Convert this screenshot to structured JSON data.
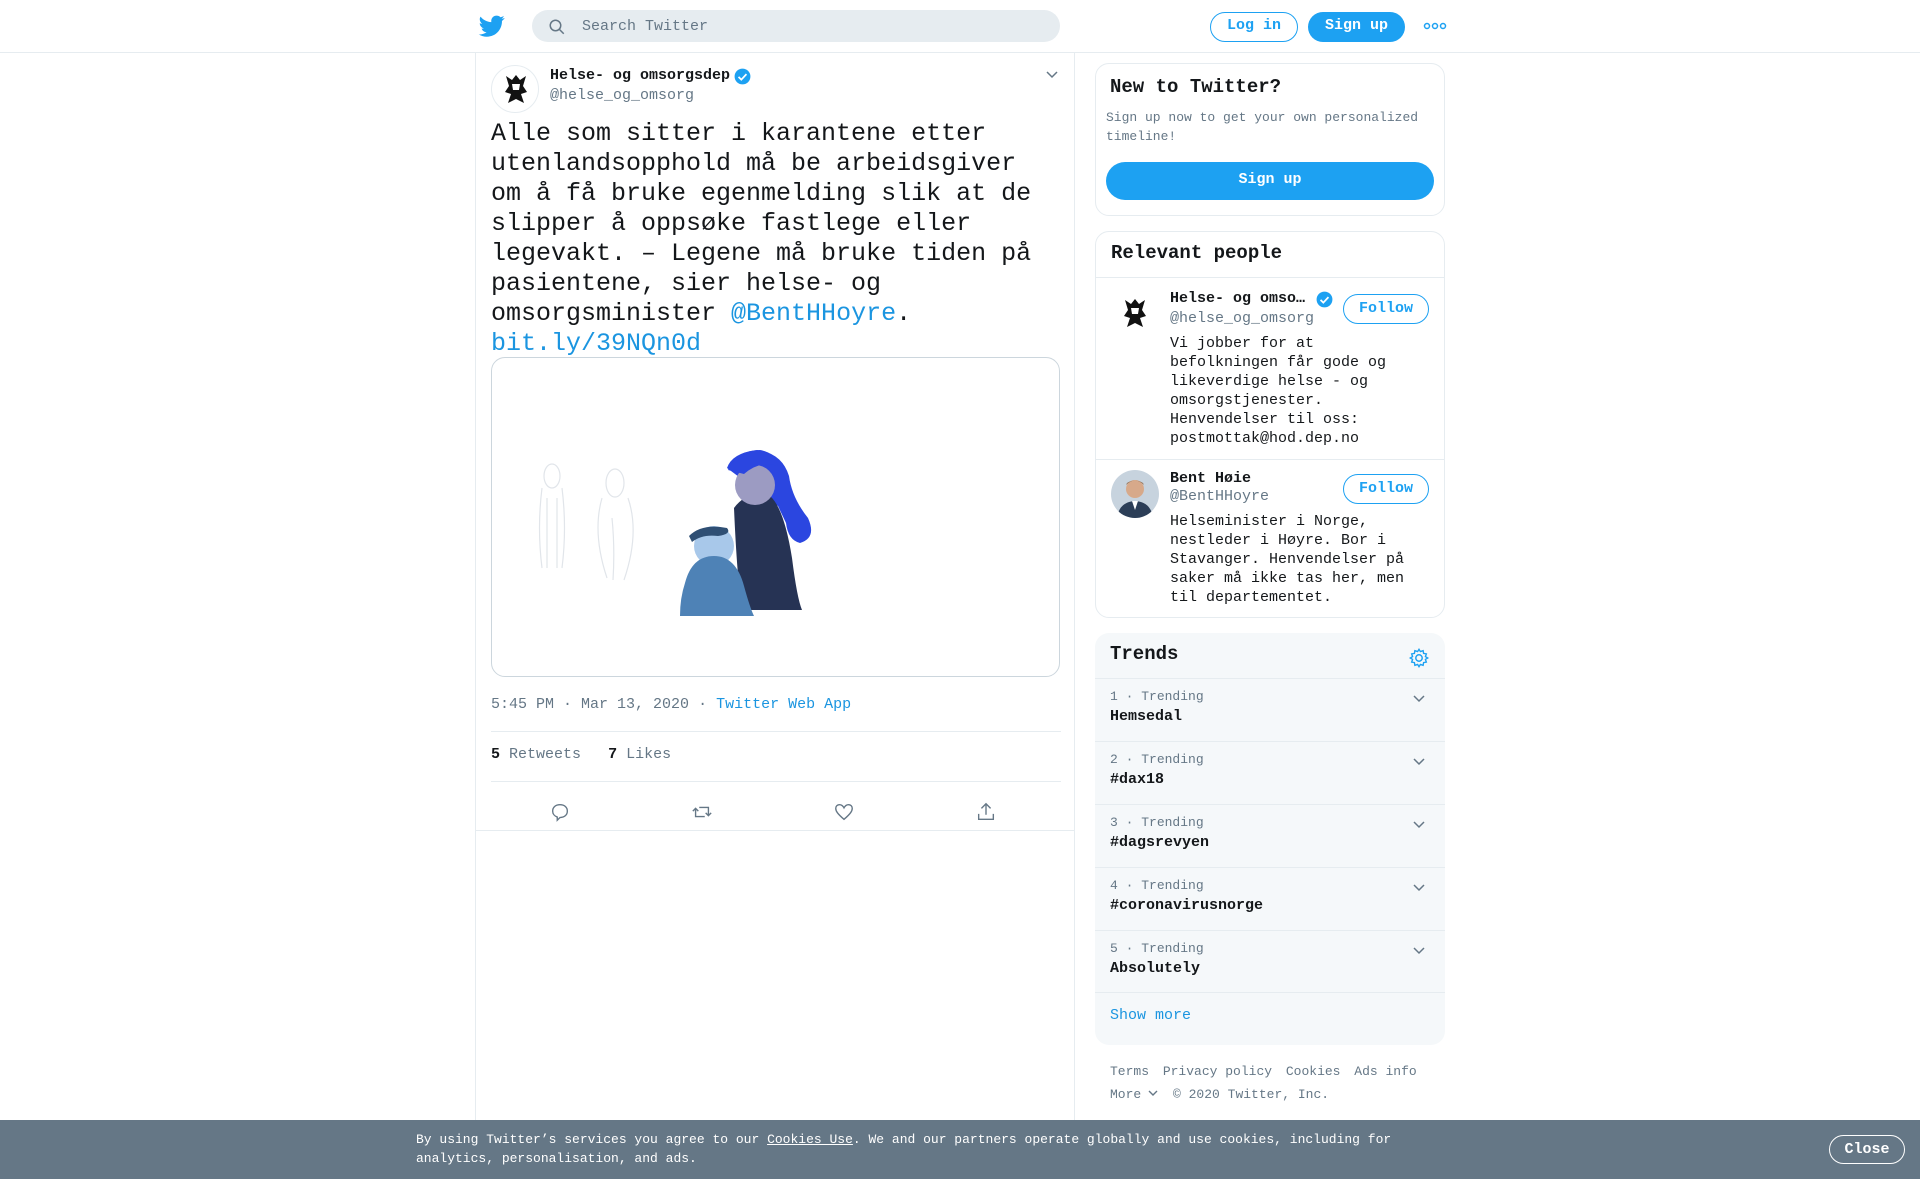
{
  "header": {
    "search_placeholder": "Search Twitter",
    "login_label": "Log in",
    "signup_label": "Sign up",
    "more_icon": "more-icon",
    "brand_color": "#1da1f2"
  },
  "tweet": {
    "author_name": "Helse- og omsorgsdep",
    "author_handle": "@helse_og_omsorg",
    "verified": true,
    "text_part1": "Alle som sitter i karantene etter utenlandsopphold må be arbeidsgiver om å få bruke egenmelding slik at de slipper å oppsøke fastlege eller legevakt. – Legene må bruke tiden på pasientene, sier helse- og omsorgsminister ",
    "mention": "@BentHHoyre",
    "text_part2": ".",
    "url": "bit.ly/39NQn0d",
    "timestamp": "5:45 PM · Mar 13, 2020",
    "dot": "·",
    "source": "Twitter Web App",
    "retweets_count": "5",
    "retweets_label": "Retweets",
    "likes_count": "7",
    "likes_label": "Likes"
  },
  "sidebar": {
    "new_to_twitter": {
      "title": "New to Twitter?",
      "description": "Sign up now to get your own personalized timeline!",
      "button": "Sign up"
    },
    "relevant_people": {
      "title": "Relevant people",
      "people": [
        {
          "name": "Helse- og omso…",
          "handle": "@helse_og_omsorg",
          "verified": true,
          "follow_label": "Follow",
          "bio": "Vi jobber for at befolkningen får gode og likeverdige helse - og omsorgstjenester. Henvendelser til oss: postmottak@hod.dep.no"
        },
        {
          "name": "Bent Høie",
          "handle": "@BentHHoyre",
          "verified": false,
          "follow_label": "Follow",
          "bio": "Helseminister i Norge, nestleder i Høyre. Bor i Stavanger. Henvendelser på saker må ikke tas her, men til departementet."
        }
      ]
    },
    "trends": {
      "title": "Trends",
      "items": [
        {
          "rank": "1",
          "label": "Trending",
          "name": "Hemsedal"
        },
        {
          "rank": "2",
          "label": "Trending",
          "name": "#dax18"
        },
        {
          "rank": "3",
          "label": "Trending",
          "name": "#dagsrevyen"
        },
        {
          "rank": "4",
          "label": "Trending",
          "name": "#coronavirusnorge"
        },
        {
          "rank": "5",
          "label": "Trending",
          "name": "Absolutely"
        }
      ],
      "show_more": "Show more"
    },
    "footer": {
      "terms": "Terms",
      "privacy": "Privacy policy",
      "cookies": "Cookies",
      "ads": "Ads info",
      "more": "More",
      "copyright": "© 2020 Twitter, Inc."
    }
  },
  "cookie_bar": {
    "text_before": "By using Twitter’s services you agree to our ",
    "link": "Cookies Use",
    "text_after": ". We and our partners operate globally and use cookies, including for analytics, personalisation, and ads.",
    "close_label": "Close"
  }
}
